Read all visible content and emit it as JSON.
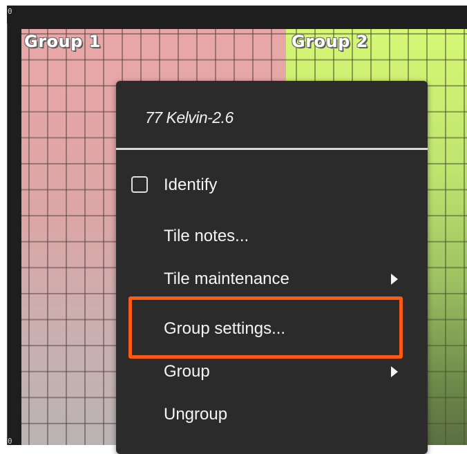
{
  "ruler": {
    "top_label": "0",
    "bottom_label": "0"
  },
  "groups": [
    {
      "label": "Group 1"
    },
    {
      "label": "Group 2"
    }
  ],
  "menu": {
    "header": "77 Kelvin-2.6",
    "items": [
      {
        "label": "Identify",
        "checkbox": true,
        "checked": false
      },
      {
        "label": "Tile notes..."
      },
      {
        "label": "Tile maintenance",
        "submenu": true
      },
      {
        "label": "Group settings...",
        "highlighted": true
      },
      {
        "label": "Group",
        "submenu": true
      },
      {
        "label": "Ungroup"
      }
    ]
  },
  "colors": {
    "highlight_border": "#ff5a14",
    "menu_background": "#2b2b2b",
    "group1_tint": "#e9a7a7",
    "group2_tint": "#d6f776"
  }
}
